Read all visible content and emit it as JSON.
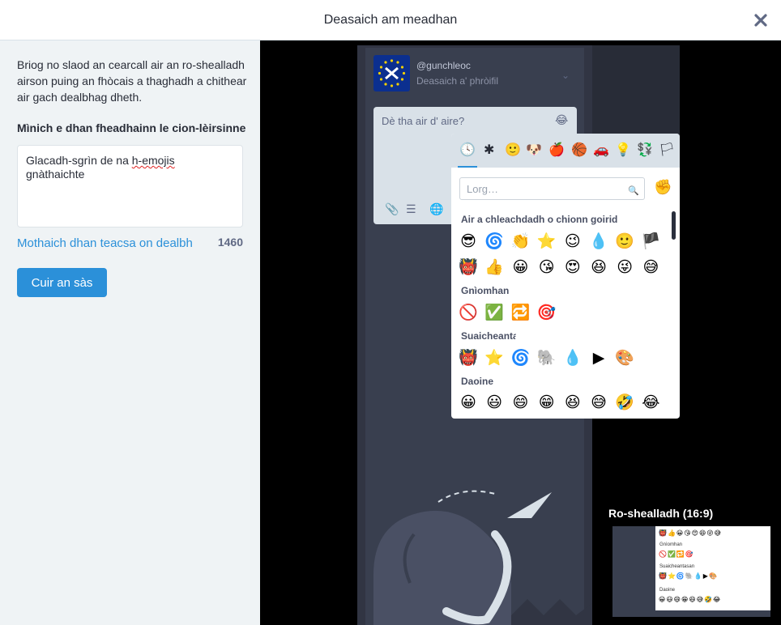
{
  "dialog": {
    "title": "Deasaich am meadhan",
    "close_icon": "close-icon"
  },
  "left": {
    "description": "Briog no slaod an cearcall air an ro-shealladh airson puing an fhòcais a thaghadh a chithear air gach dealbhag dheth.",
    "field_label": "Mìnich e dhan fheadhainn le cion-lèirsinne",
    "alt_text_prefix": "Glacadh-sgrìn de na ",
    "alt_text_word": "h-emojis",
    "alt_text_suffix": " gnàthaichte",
    "ocr_link": "Mothaich dhan teacsa on dealbh",
    "char_count": "1460",
    "apply_button": "Cuir an sàs"
  },
  "screenshot": {
    "username": "@gunchleoc",
    "edit_profile": "Deasaich a' phròifil",
    "compose_placeholder": "Dè tha air d' aire?",
    "search_placeholder": "Lorg…",
    "sections": {
      "recent": "Air a chleachdadh o chionn goirid",
      "actions": "Gnìomhan",
      "badges": "Suaicheantasan",
      "people": "Daoine"
    },
    "categories": [
      "🕓",
      "✱",
      "🙂",
      "🐶",
      "🍎",
      "🏀",
      "🚗",
      "💡",
      "💱",
      "🏳"
    ],
    "recent_row1": [
      "😎",
      "🌀",
      "👏",
      "⭐",
      "😉",
      "💧",
      "🙂",
      "🏴"
    ],
    "recent_row2": [
      "👹",
      "👍",
      "😀",
      "😘",
      "😍",
      "😆",
      "😜",
      "😅"
    ],
    "actions_row": [
      "🚫",
      "✅",
      "🔁",
      "🎯"
    ],
    "badges_row": [
      "👹",
      "⭐",
      "🌀",
      "🐘",
      "💧",
      "▶",
      "🎨"
    ],
    "people_row": [
      "😀",
      "😃",
      "😄",
      "😁",
      "😆",
      "😅",
      "🤣",
      "😂"
    ],
    "tone_emoji": "✊"
  },
  "preview": {
    "label": "Ro-shealladh (16:9)",
    "sections": {
      "actions": "Gnìomhan",
      "badges": "Suaicheantasan",
      "people": "Daoine"
    },
    "row1": "👹👍😀😘😍😆😜😅",
    "row2": "🚫✅🔁🎯",
    "row3": "👹⭐🌀🐘💧▶🎨",
    "row4": "😀😃😄😁😆😅🤣😂"
  }
}
